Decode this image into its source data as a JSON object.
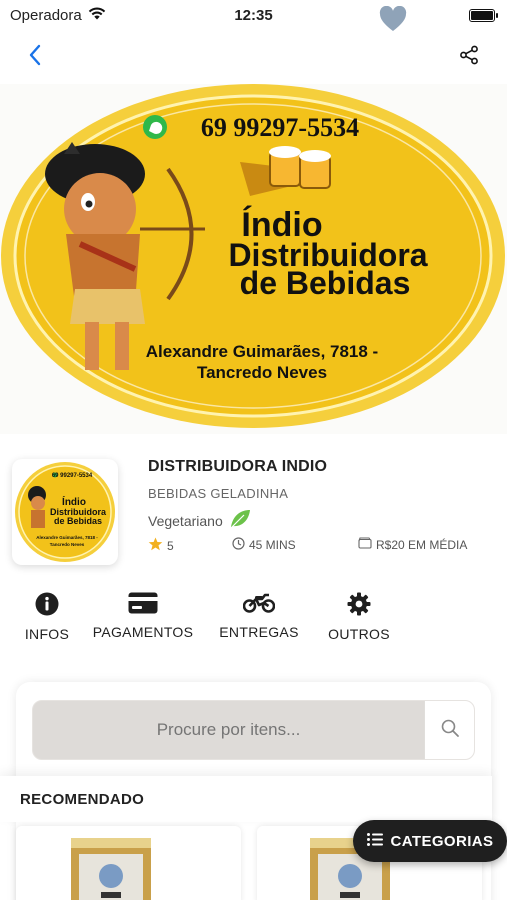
{
  "status_bar": {
    "carrier": "Operadora",
    "time": "12:35"
  },
  "banner": {
    "phone": "69 99297-5534",
    "title_line1": "Índio",
    "title_line2": "Distribuidora",
    "title_line3": "de Bebidas",
    "address_line1": "Alexandre Guimarães, 7818 -",
    "address_line2": "Tancredo Neves",
    "colors": {
      "yellow": "#f2c21a",
      "ring": "#f5cf3c",
      "text": "#111111"
    }
  },
  "store": {
    "name": "DISTRIBUIDORA INDIO",
    "category": "BEBIDAS GELADINHA",
    "tag": "Vegetariano",
    "rating": "5",
    "delivery_time": "45 MINS",
    "average_price": "R$20 EM MÉDIA"
  },
  "actions": [
    {
      "label": "INFOS",
      "icon": "info-icon"
    },
    {
      "label": "PAGAMENTOS",
      "icon": "credit-card-icon"
    },
    {
      "label": "ENTREGAS",
      "icon": "motorcycle-icon"
    },
    {
      "label": "OUTROS",
      "icon": "gear-icon"
    }
  ],
  "search": {
    "placeholder": "Procure por itens..."
  },
  "sections": {
    "recommended": "RECOMENDADO"
  },
  "fab": {
    "label": "CATEGORIAS"
  },
  "colors": {
    "accent_blue": "#1a73e8",
    "star": "#f2b01e",
    "leaf": "#6cc24a"
  }
}
